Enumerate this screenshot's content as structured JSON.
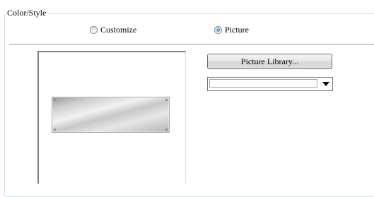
{
  "group": {
    "title": "Color/Style"
  },
  "options": [
    {
      "label": "Customize",
      "checked": false
    },
    {
      "label": "Picture",
      "checked": true
    }
  ],
  "buttons": {
    "picture_library": "Picture Library..."
  },
  "picture_select": {
    "value": ""
  },
  "preview": {
    "image": "metal-plate"
  }
}
